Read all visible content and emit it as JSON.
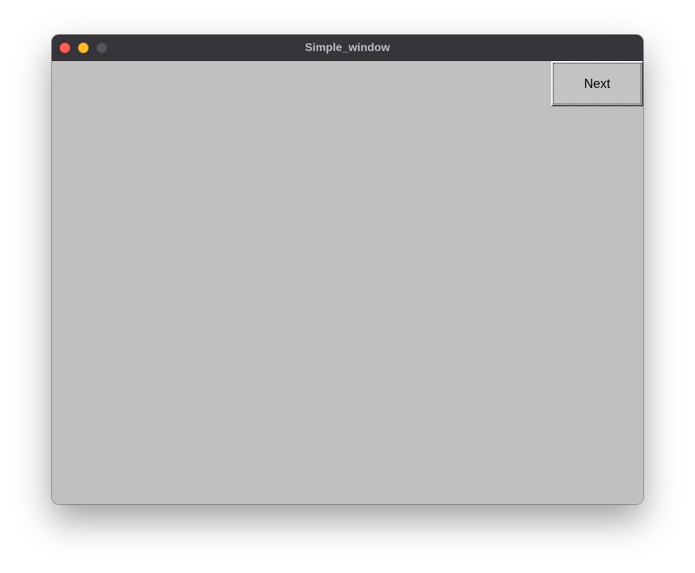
{
  "window": {
    "title": "Simple_window",
    "controls": {
      "close": {
        "icon": "close-dot-icon",
        "color": "#fe5f57"
      },
      "minimize": {
        "icon": "minimize-dot-icon",
        "color": "#febc2e"
      },
      "zoom": {
        "icon": "zoom-dot-icon",
        "color": "#57545b"
      }
    },
    "colors": {
      "titlebar": "#37343a",
      "title_text": "#bebbc2",
      "content_background": "#c0c0c0"
    }
  },
  "content": {
    "next_button": {
      "label": "Next"
    }
  }
}
